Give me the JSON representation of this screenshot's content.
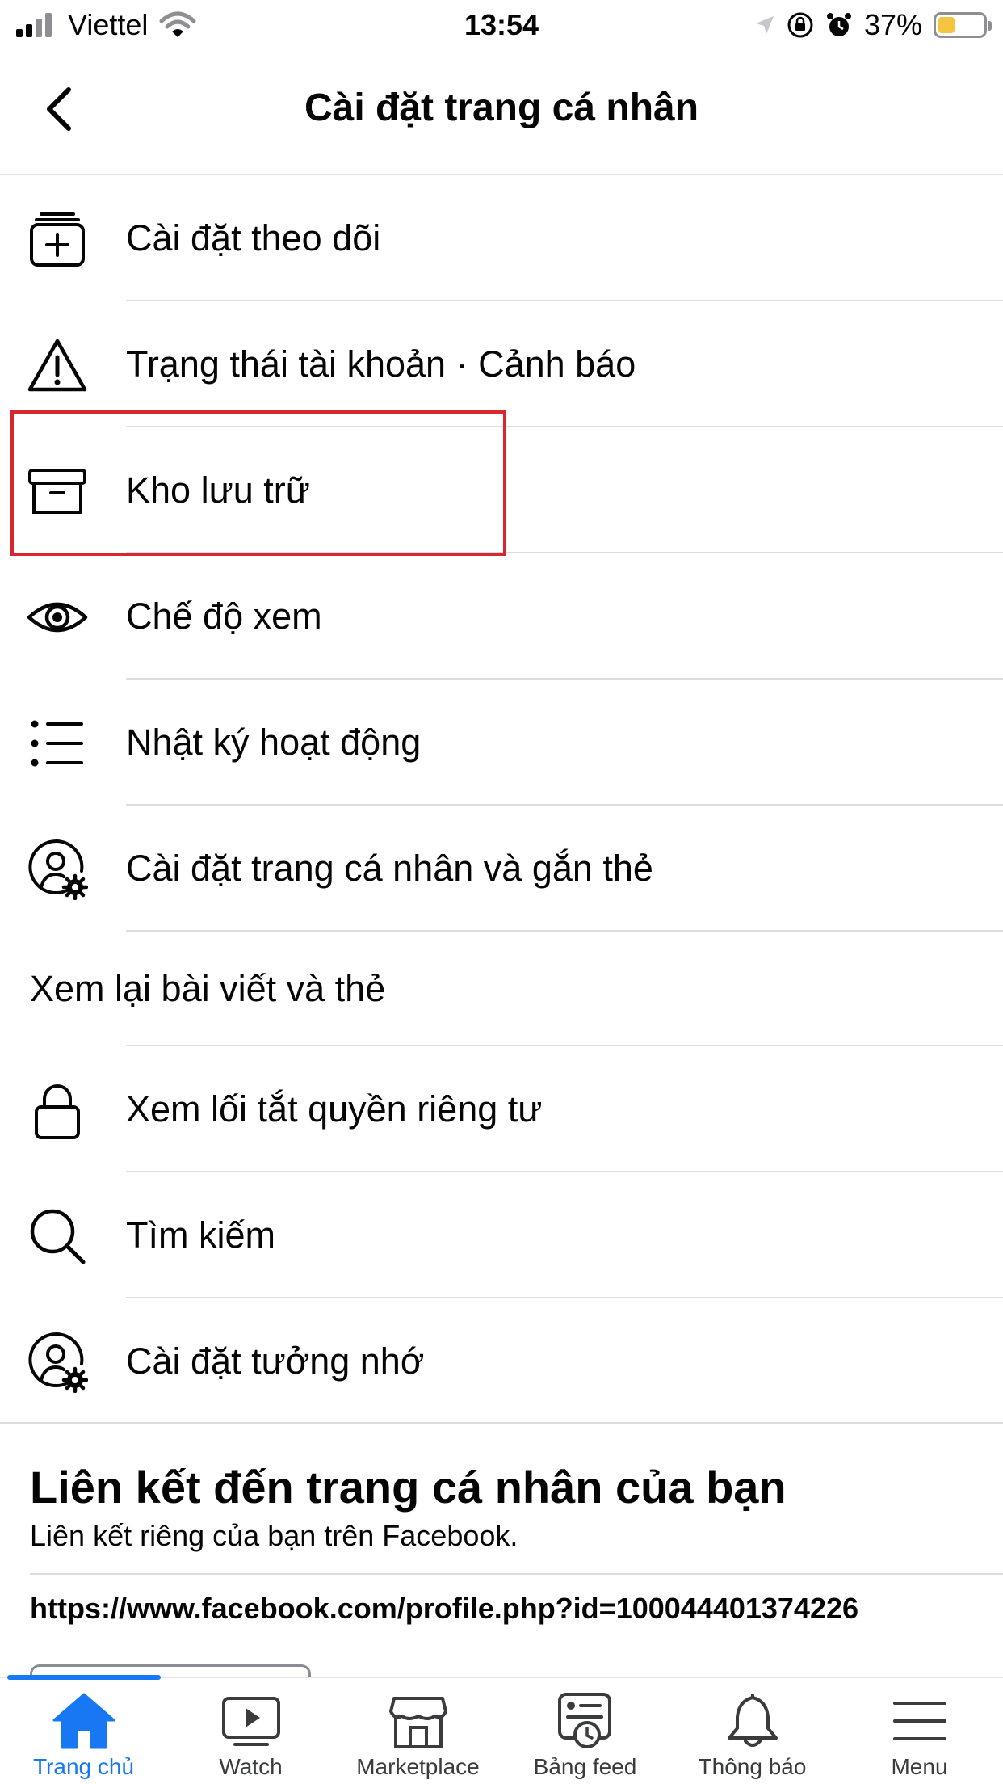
{
  "status_bar": {
    "carrier": "Viettel",
    "time": "13:54",
    "battery": "37%",
    "battery_level": 0.37
  },
  "header": {
    "title": "Cài đặt trang cá nhân"
  },
  "settings": {
    "items": [
      {
        "label": "Cài đặt theo dõi",
        "icon": "follow-settings-icon"
      },
      {
        "label": "Trạng thái tài khoản · Cảnh báo",
        "icon": "warning-icon"
      },
      {
        "label": "Kho lưu trữ",
        "icon": "archive-icon"
      },
      {
        "label": "Chế độ xem",
        "icon": "eye-icon"
      },
      {
        "label": "Nhật ký hoạt động",
        "icon": "list-icon"
      },
      {
        "label": "Cài đặt trang cá nhân và gắn thẻ",
        "icon": "profile-gear-icon"
      },
      {
        "label": "Xem lại bài viết và thẻ",
        "icon": ""
      },
      {
        "label": "Xem lối tắt quyền riêng tư",
        "icon": "lock-icon"
      },
      {
        "label": "Tìm kiếm",
        "icon": "search-icon"
      },
      {
        "label": "Cài đặt tưởng nhớ",
        "icon": "profile-gear-icon"
      }
    ]
  },
  "profile_link": {
    "title": "Liên kết đến trang cá nhân của bạn",
    "description": "Liên kết riêng của bạn trên Facebook.",
    "url": "https://www.facebook.com/profile.php?id=100044401374226"
  },
  "tab_bar": {
    "tabs": [
      {
        "label": "Trang chủ",
        "icon": "home-icon",
        "active": true
      },
      {
        "label": "Watch",
        "icon": "watch-icon",
        "active": false
      },
      {
        "label": "Marketplace",
        "icon": "marketplace-icon",
        "active": false
      },
      {
        "label": "Bảng feed",
        "icon": "feed-icon",
        "active": false
      },
      {
        "label": "Thông báo",
        "icon": "bell-icon",
        "active": false
      },
      {
        "label": "Menu",
        "icon": "menu-icon",
        "active": false
      }
    ]
  },
  "colors": {
    "accent": "#1877f2",
    "highlight": "#d7282f",
    "text": "#050505",
    "divider": "#dadde1",
    "battery": "#f5c542"
  }
}
